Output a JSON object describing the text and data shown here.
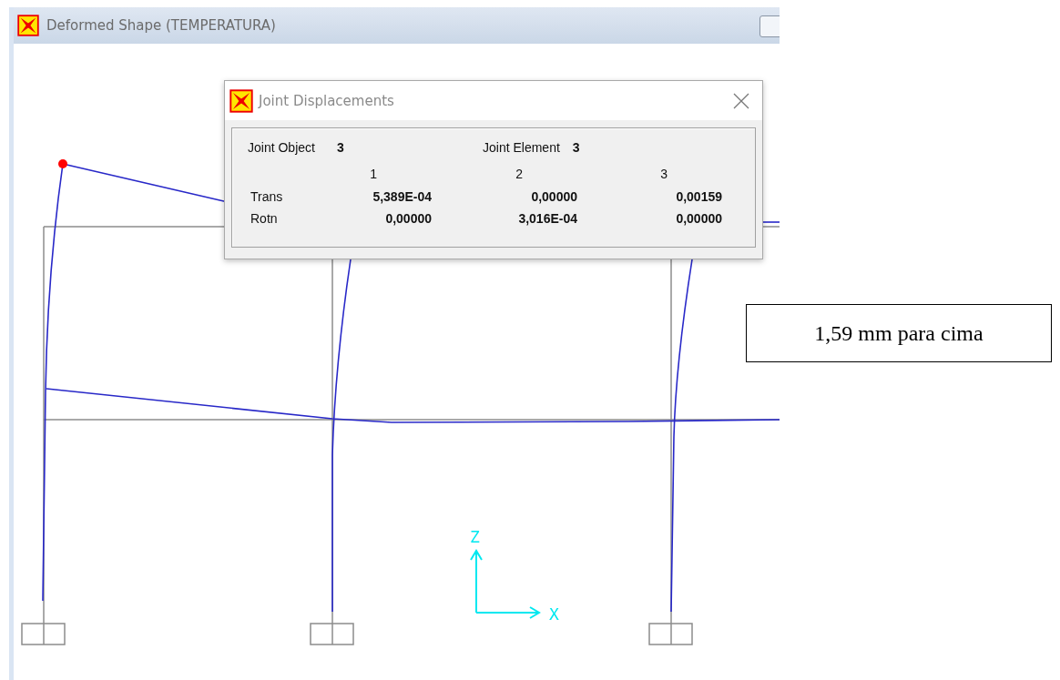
{
  "window": {
    "title": "Deformed Shape (TEMPERATURA)"
  },
  "dialog": {
    "title": "Joint Displacements",
    "joint_object": {
      "label": "Joint  Object",
      "value": "3"
    },
    "joint_element": {
      "label": "Joint Element",
      "value": "3"
    },
    "columns": [
      "1",
      "2",
      "3"
    ],
    "rows": [
      {
        "label": "Trans",
        "values": [
          "5,389E-04",
          "0,00000",
          "0,00159"
        ]
      },
      {
        "label": "Rotn",
        "values": [
          "0,00000",
          "3,016E-04",
          "0,00000"
        ]
      }
    ]
  },
  "axes": {
    "vertical": "Z",
    "horizontal": "X"
  },
  "annotation": "1,59 mm para cima"
}
